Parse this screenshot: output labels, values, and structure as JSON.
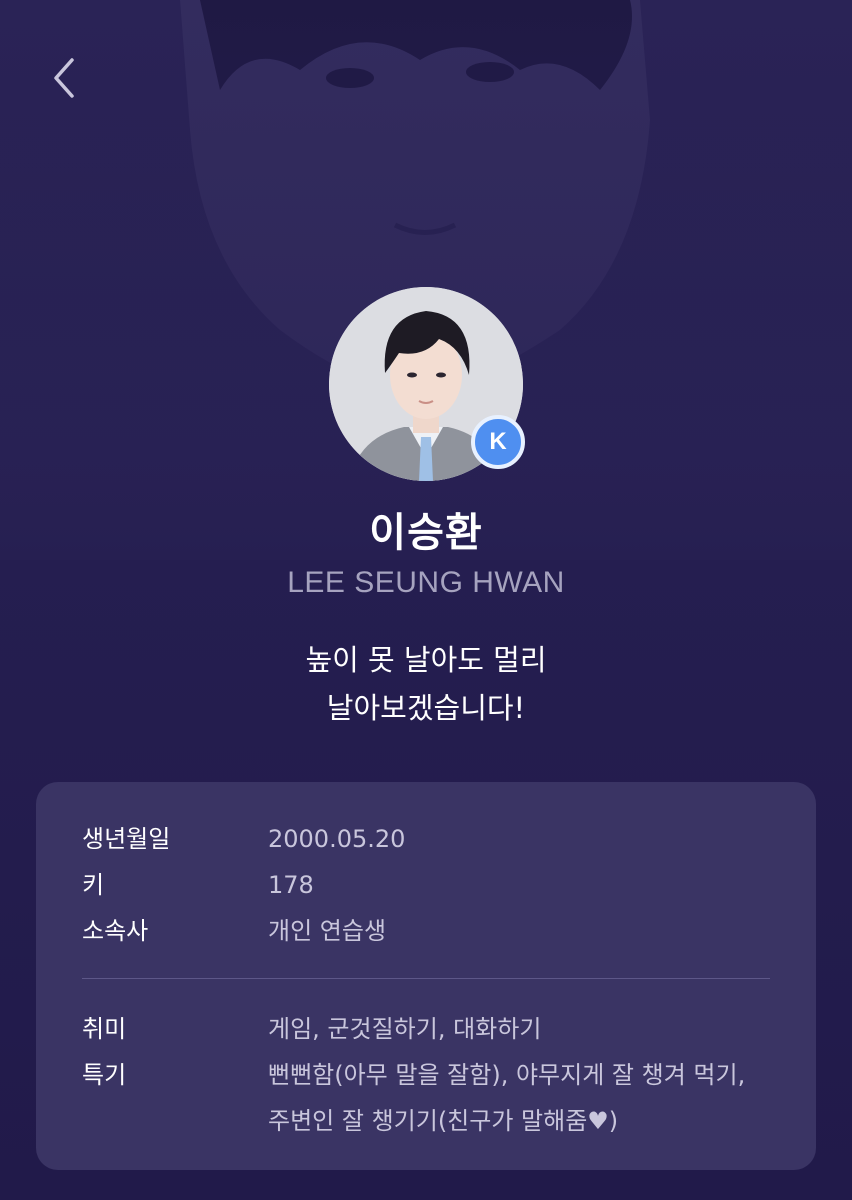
{
  "header": {
    "back_icon": "chevron-left-icon"
  },
  "profile": {
    "name_ko": "이승환",
    "name_en": "LEE SEUNG HWAN",
    "badge_letter": "K",
    "badge_color": "#4f8ff0",
    "motto_line1": "높이 못 날아도 멀리",
    "motto_line2": "날아보겠습니다!"
  },
  "info": {
    "birth_label": "생년월일",
    "birth_value": "2000.05.20",
    "height_label": "키",
    "height_value": "178",
    "agency_label": "소속사",
    "agency_value": "개인 연습생",
    "hobby_label": "취미",
    "hobby_value": "게임, 군것질하기, 대화하기",
    "talent_label": "특기",
    "talent_value_line1": "뻔뻔함(아무 말을 잘함), 야무지게 잘 챙겨 먹기,",
    "talent_value_line2": "주변인 잘 챙기기(친구가 말해줌♥)"
  },
  "colors": {
    "background": "#241d4e",
    "card": "#3a3464",
    "secondary_text": "#a6a3bf"
  }
}
